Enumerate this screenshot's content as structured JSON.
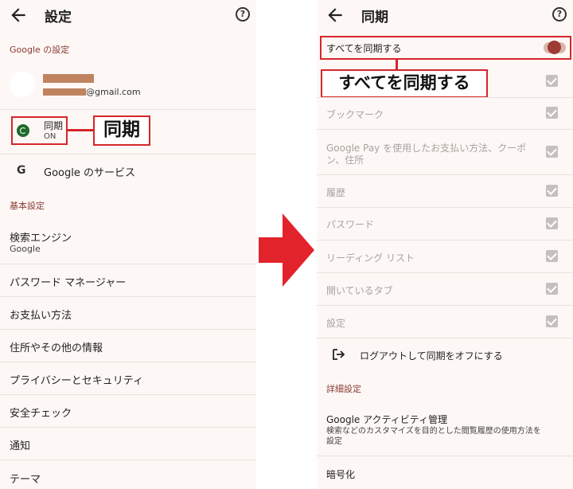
{
  "left": {
    "title": "設定",
    "help": "?",
    "section_google": "Google の設定",
    "email_suffix": "@gmail.com",
    "sync_label": "同期",
    "sync_status": "ON",
    "sync_callout": "同期",
    "google_services_icon": "G",
    "google_services": "Google のサービス",
    "section_basic": "基本設定",
    "search_engine": "検索エンジン",
    "search_engine_value": "Google",
    "items": [
      "パスワード マネージャー",
      "お支払い方法",
      "住所やその他の情報",
      "プライバシーとセキュリティ",
      "安全チェック",
      "通知",
      "テーマ"
    ]
  },
  "right": {
    "title": "同期",
    "help": "?",
    "sync_all": "すべてを同期する",
    "sync_all_callout": "すべてを同期する",
    "items": [
      "ブックマーク",
      "Google Pay を使用したお支払い方法、クーポン、住所",
      "履歴",
      "パスワード",
      "リーディング リスト",
      "開いているタブ",
      "設定"
    ],
    "google_pay_line1": "Google Pay を使用したお支払い方法、クーポ",
    "google_pay_line2": "ン、住所",
    "logout": "ログアウトして同期をオフにする",
    "section_advanced": "詳細設定",
    "activity_title": "Google アクティビティ管理",
    "activity_sub_line1": "検索などのカスタマイズを目的とした閲覧履歴の使用方法を",
    "activity_sub_line2": "設定",
    "encryption": "暗号化"
  },
  "colors": {
    "accent_red": "#d6262b",
    "toggle_on": "#9e3b34",
    "background": "#fdf8f5",
    "section_text": "#8a3a34"
  },
  "icons": [
    "back-arrow-icon",
    "help-icon",
    "sync-icon",
    "google-g-icon",
    "right-arrow-icon",
    "checkbox-icon",
    "logout-icon"
  ]
}
